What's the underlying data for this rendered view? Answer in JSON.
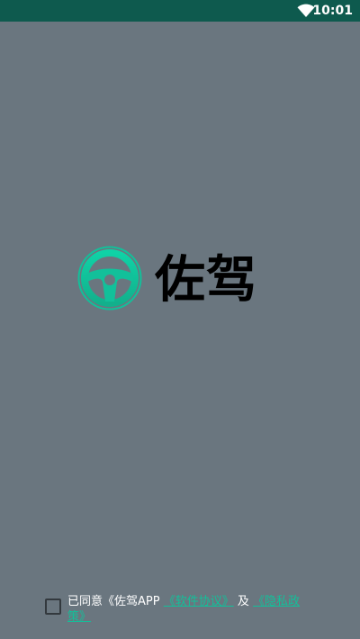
{
  "colors": {
    "status_bar": "#0e5a4e",
    "background": "#6a767f",
    "brand_accent": "#12c09a",
    "app_name": "#000000",
    "checkbox_border": "#33393e"
  },
  "status_bar": {
    "time": "10:01",
    "icons": [
      "wifi-icon"
    ]
  },
  "splash": {
    "logo_icon": "steering-wheel-icon",
    "app_name": "佐驾"
  },
  "agreement": {
    "checked": false,
    "prefix": "已同意《佐驾APP",
    "link_1": "《软件协议》",
    "connector": "及",
    "link_2": "《隐私政策》"
  }
}
